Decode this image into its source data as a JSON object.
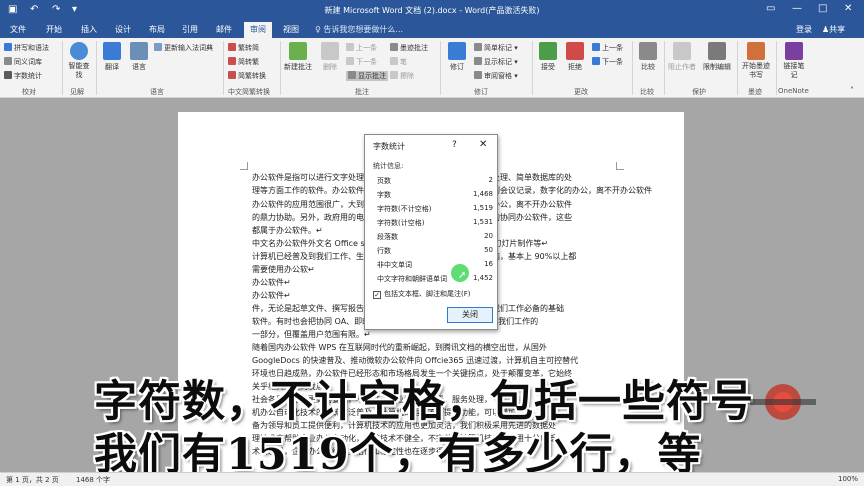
{
  "titlebar": {
    "title": "新建 Microsoft Word 文档 (2).docx - Word(产品激活失败)",
    "save_icon": "save-icon",
    "undo_icon": "undo-icon",
    "redo_icon": "redo-icon",
    "customize_icon": "customize-quick-access-icon",
    "restore_icon": "ribbon-display-icon",
    "minimize": "—",
    "maximize": "□",
    "close": "✕"
  },
  "tabs": [
    "文件",
    "开始",
    "插入",
    "设计",
    "布局",
    "引用",
    "邮件",
    "审阅",
    "视图"
  ],
  "active_tab": "审阅",
  "tell_me": "告诉我您想要做什么...",
  "login": "登录",
  "share": "共享",
  "ribbon": {
    "proofing": {
      "spelling": "拼写和语法",
      "thesaurus": "同义词库",
      "word_count": "字数统计",
      "label": "校对"
    },
    "insights": {
      "smart_lookup": "智能查找",
      "label": "见解"
    },
    "language": {
      "translate": "翻译",
      "language": "语言",
      "update_ime": "更新输入法词典",
      "label": "语言"
    },
    "chinese_conversion": {
      "to_simplified": "繁转简",
      "to_traditional": "简转繁",
      "convert": "简繁转换",
      "label": "中文简繁转换"
    },
    "comments": {
      "new_comment": "新建批注",
      "delete": "删除",
      "previous": "上一条",
      "next": "下一条",
      "show_comments": "显示批注",
      "label": "批注"
    },
    "ink": {
      "ink_comment": "墨迹批注",
      "pen": "笔",
      "eraser": "擦除"
    },
    "tracking": {
      "track_changes": "修订",
      "simple_markup": "简单标记",
      "show_markup": "显示标记",
      "reviewing_pane": "审阅窗格",
      "label": "修订"
    },
    "changes": {
      "accept": "接受",
      "reject": "拒绝",
      "previous": "上一条",
      "next": "下一条",
      "label": "更改"
    },
    "compare": {
      "compare": "比较",
      "label": "比较"
    },
    "protect": {
      "block_authors": "阻止作者",
      "restrict_editing": "限制编辑",
      "label": "保护"
    },
    "ink_group": {
      "start_inking": "开始墨迹书写",
      "label": "墨迹"
    },
    "onenote": {
      "linked_notes": "链接笔记",
      "label": "OneNote"
    }
  },
  "document": {
    "lines": [
      "办公软件是指可以进行文字处理、表格制作、幻灯片制作、图形图像处理、简单数据库的处",
      "理等方面工作的软件。办公软件的应用范围很广，大到社会统计，小到会议记录，数字化的办公，离不开办公软件",
      "办公软件的应用范围很广，大到社会统计，小到会议记录，数字化的办公，离不开办公软件",
      "的鼎力协助。另外，政府用的电子政务，税务用的税务系统，企业用的协同办公软件，这些",
      "都属于办公软件。↵",
      "中文名办公软件外文名 Office software 作用文字处理、表格制作、幻灯片制作等↵",
      "计算机已经普及到我们工作、生活的方方面面，办公室、家庭都有电脑，基本上 90%以上都",
      "需要使用办公软↵",
      "办公软件↵",
      "办公软件↵",
      "件，无论是起草文件、撰写报告，还是统计数据，办公软件已经成为我们工作必备的基础",
      "软件。有时也会把协同 OA、即时通讯等称为办公软件，它们也是支撑我们工作的",
      "一部分，但覆盖用户范围有限。↵",
      "随着国内办公软件 WPS 在互联网时代的重新崛起，到腾讯文档的横空出世，从国外",
      "GoogleDocs 的快速普及、推动微软办公软件向 Offcie365 迅速过渡，计算机自主可控替代",
      "环境也日趋成熟，办公软件已经形态和市场格局发生一个关键拐点，处于颠覆变革，它始终",
      "关乎相关企业的发展。",
      "社会各界提出了更高的要求，不断推进产业和服务升级，服务处理，",
      "机办公自动化技术的系统广泛普及，计算机的运用不断提高功能，可以增加",
      "备为领导和员工提供便利，计算机技术的应用也更加灵活，我们积极采用先进的数据处",
      "理技术来帮助企业办公自动化，系统技术不健全，不完善，计算机技术的应用十分广泛",
      "术的发展，企业办公系统的灵活性和稳定性也在逐步得到加强。"
    ]
  },
  "dialog": {
    "title": "字数统计",
    "help": "?",
    "close_x": "✕",
    "section": "统计信息:",
    "stats": [
      {
        "label": "页数",
        "value": "2"
      },
      {
        "label": "字数",
        "value": "1,468"
      },
      {
        "label": "字符数(不计空格)",
        "value": "1,519"
      },
      {
        "label": "字符数(计空格)",
        "value": "1,531"
      },
      {
        "label": "段落数",
        "value": "20"
      },
      {
        "label": "行数",
        "value": "50"
      },
      {
        "label": "非中文单词",
        "value": "16"
      },
      {
        "label": "中文字符和朝鲜语单词",
        "value": "1,452"
      }
    ],
    "include_label": "包括文本框、脚注和尾注(F)",
    "include_checked": true,
    "close_button": "关闭"
  },
  "captions": {
    "line1": "字符数，不计空格，包括一些符号",
    "line2": "我们有1519个，有多少行，等"
  },
  "statusbar": {
    "page": "第 1 页，共 2 页",
    "words": "1468 个字",
    "zoom": "100%"
  },
  "colors": {
    "accent": "#2b579a",
    "ribbon_bg": "#f3f3f3",
    "cursor": "#4cd964"
  }
}
